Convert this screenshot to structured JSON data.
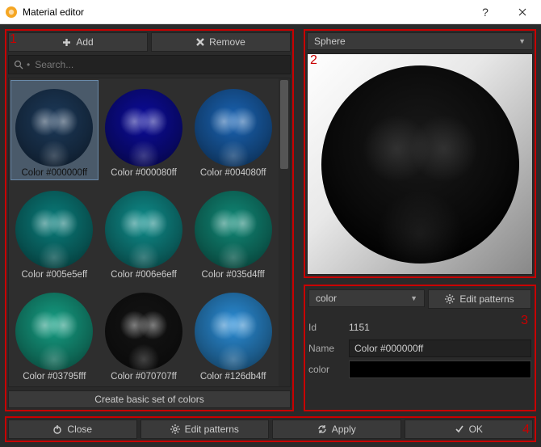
{
  "window": {
    "title": "Material editor"
  },
  "left": {
    "add_label": "Add",
    "remove_label": "Remove",
    "search_placeholder": "Search...",
    "create_label": "Create basic set of colors",
    "materials": [
      {
        "label": "Color #000000ff",
        "color": "#1d3a5a",
        "selected": true
      },
      {
        "label": "Color #000080ff",
        "color": "#0c0c9b"
      },
      {
        "label": "Color #004080ff",
        "color": "#1a64b4"
      },
      {
        "label": "Color #005e5eff",
        "color": "#0a7e7c"
      },
      {
        "label": "Color #006e6eff",
        "color": "#0f8e8c"
      },
      {
        "label": "Color #035d4fff",
        "color": "#118a78"
      },
      {
        "label": "Color #03795fff",
        "color": "#16a085"
      },
      {
        "label": "Color #070707ff",
        "color": "#141414"
      },
      {
        "label": "Color #126db4ff",
        "color": "#2b8ed8"
      }
    ]
  },
  "preview": {
    "shape_options": [
      "Sphere"
    ],
    "shape_selected": "Sphere"
  },
  "props": {
    "mode_selected": "color",
    "edit_patterns_label": "Edit patterns",
    "id_label": "Id",
    "id_value": "1151",
    "name_label": "Name",
    "name_value": "Color #000000ff",
    "color_label": "color",
    "color_value": "#000000"
  },
  "bottom": {
    "close_label": "Close",
    "edit_patterns_label": "Edit patterns",
    "apply_label": "Apply",
    "ok_label": "OK"
  },
  "region_labels": {
    "r1": "1",
    "r2": "2",
    "r3": "3",
    "r4": "4"
  }
}
